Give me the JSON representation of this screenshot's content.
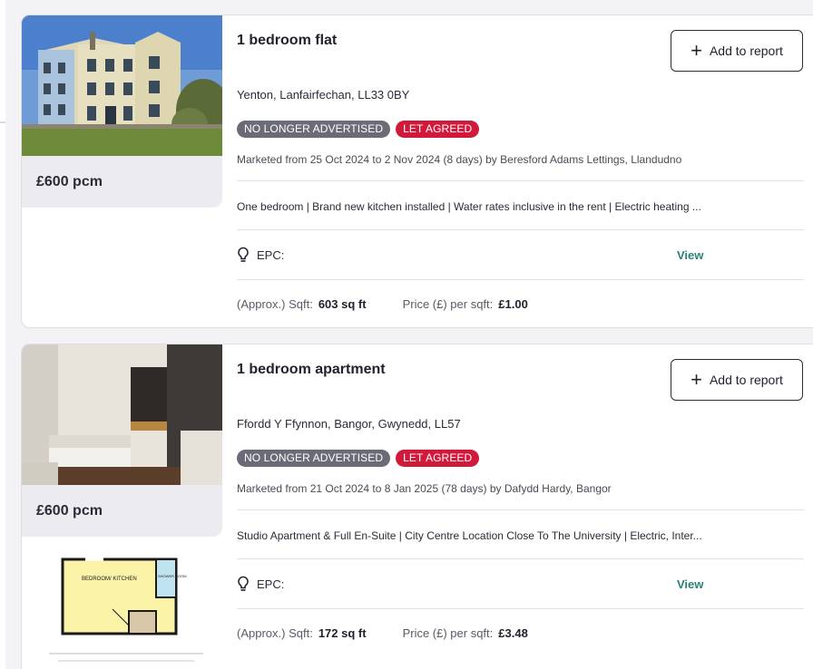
{
  "listings": [
    {
      "title": "1 bedroom flat",
      "add_label": "Add to report",
      "address": "Yenton, Lanfairfechan, LL33 0BY",
      "status_badge": "NO LONGER ADVERTISED",
      "let_badge": "LET AGREED",
      "marketed": "Marketed from 25 Oct 2024 to 2 Nov 2024 (8 days) by Beresford Adams Lettings, Llandudno",
      "features": "One bedroom | Brand new kitchen installed | Water rates inclusive in the rent | Electric heating ...",
      "epc_label": "EPC:",
      "view_label": "View",
      "sqft_label": "(Approx.) Sqft:",
      "sqft_value": "603 sq ft",
      "ppsf_label": "Price (£) per sqft:",
      "ppsf_value": "£1.00",
      "price": "£600 pcm"
    },
    {
      "title": "1 bedroom apartment",
      "add_label": "Add to report",
      "address": "Ffordd Y Ffynnon, Bangor, Gwynedd, LL57",
      "status_badge": "NO LONGER ADVERTISED",
      "let_badge": "LET AGREED",
      "marketed": "Marketed from 21 Oct 2024 to 8 Jan 2025 (78 days) by Dafydd Hardy, Bangor",
      "features": "Studio Apartment & Full En-Suite | City Centre Location Close To The University | Electric, Inter...",
      "epc_label": "EPC:",
      "view_label": "View",
      "sqft_label": "(Approx.) Sqft:",
      "sqft_value": "172 sq ft",
      "ppsf_label": "Price (£) per sqft:",
      "ppsf_value": "£3.48",
      "price": "£600 pcm",
      "floorplan": {
        "room1": "BEDROOM/ KITCHEN",
        "room2": "SHOWER ROOM"
      }
    }
  ],
  "colors": {
    "badge_grey": "#6b6b78",
    "badge_red": "#d11a3b",
    "link": "#2d7f79"
  }
}
